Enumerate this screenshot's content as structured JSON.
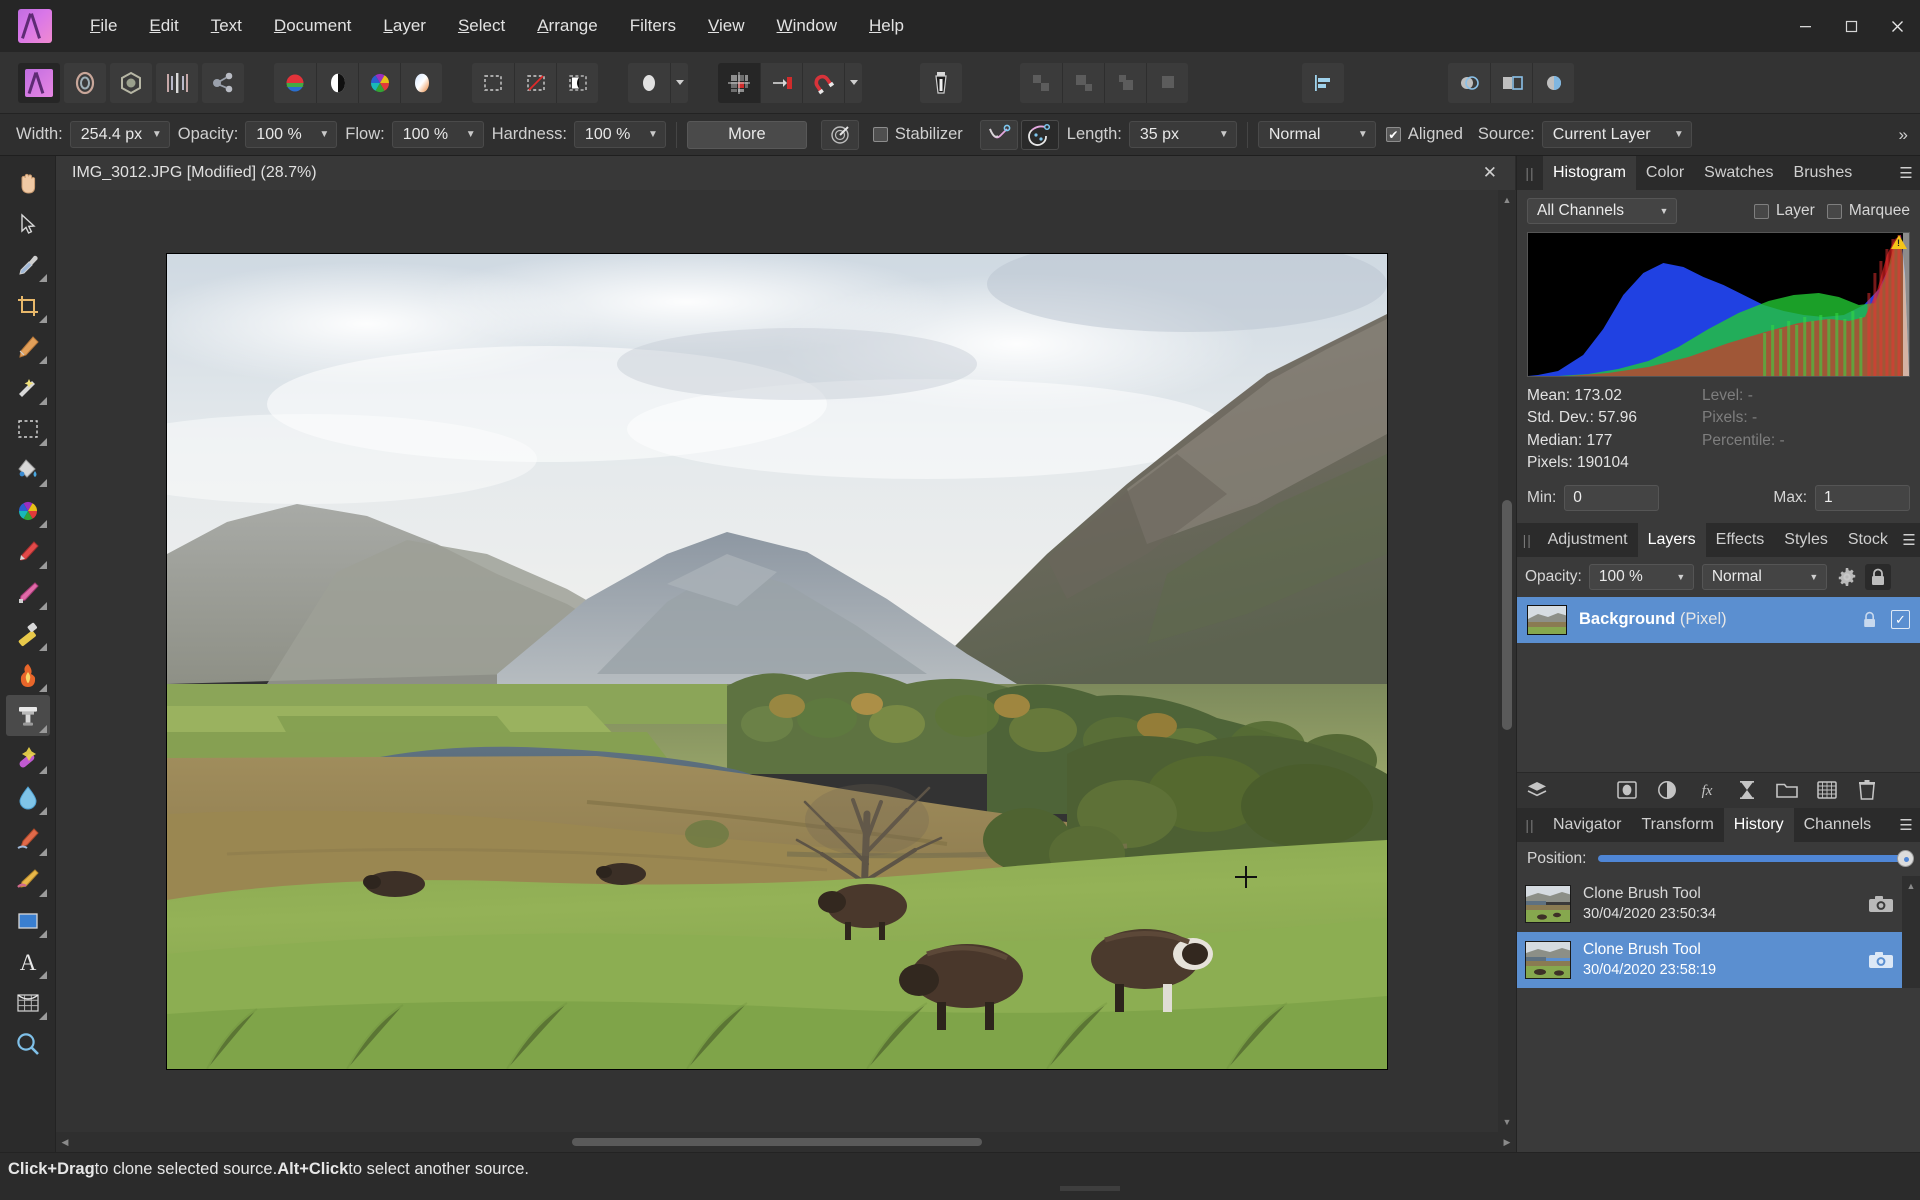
{
  "app": {
    "name": "Affinity Photo",
    "logo_icon": "affinity-photo-logo"
  },
  "menubar": {
    "items": [
      {
        "label": "File",
        "accel": "F"
      },
      {
        "label": "Edit",
        "accel": "E"
      },
      {
        "label": "Text",
        "accel": "T"
      },
      {
        "label": "Document",
        "accel": "D"
      },
      {
        "label": "Layer",
        "accel": "L"
      },
      {
        "label": "Select",
        "accel": "S"
      },
      {
        "label": "Arrange",
        "accel": "A"
      },
      {
        "label": "Filters",
        "accel": ""
      },
      {
        "label": "View",
        "accel": "V"
      },
      {
        "label": "Window",
        "accel": "W"
      },
      {
        "label": "Help",
        "accel": "H"
      }
    ],
    "window_controls": {
      "minimize": "—",
      "maximize": "❐",
      "close": "✕"
    }
  },
  "toolbar": {
    "groups": [
      {
        "buttons": [
          {
            "name": "persona-photo",
            "icon": "affinity-photo-persona",
            "active": true
          },
          {
            "name": "persona-liquify",
            "icon": "liquify-persona",
            "active": false
          },
          {
            "name": "persona-develop",
            "icon": "develop-persona",
            "active": false
          },
          {
            "name": "persona-tone-mapping",
            "icon": "tone-mapping-persona",
            "active": false
          },
          {
            "name": "persona-export",
            "icon": "export-persona",
            "active": false
          }
        ]
      },
      {
        "buttons": [
          {
            "name": "assistant-colour",
            "icon": "colour-swatch-icon",
            "active": false
          },
          {
            "name": "assistant-contrast",
            "icon": "contrast-circle-icon",
            "active": false
          },
          {
            "name": "assistant-colour-wheel",
            "icon": "colour-wheel-icon",
            "active": false
          },
          {
            "name": "assistant-gradient",
            "icon": "gradient-egg-icon",
            "active": false
          }
        ]
      },
      {
        "buttons": [
          {
            "name": "show-selection",
            "icon": "marquee-dashed-icon",
            "active": false
          },
          {
            "name": "refine-selection",
            "icon": "marquee-slash-icon",
            "active": false
          },
          {
            "name": "selection-mask",
            "icon": "selection-mask-icon",
            "active": false
          }
        ]
      },
      {
        "buttons": [
          {
            "name": "pixel-alignment",
            "icon": "ellipse-white-icon",
            "active": false
          },
          {
            "name": "pixel-alignment-menu",
            "icon": "chevron-down-icon",
            "active": false
          }
        ]
      },
      {
        "buttons": [
          {
            "name": "show-grid",
            "icon": "grid-icon",
            "active": true
          },
          {
            "name": "snap-to-edge",
            "icon": "arrow-to-bracket-icon",
            "active": false
          },
          {
            "name": "snapping-magnet",
            "icon": "magnet-icon",
            "active": false
          },
          {
            "name": "snapping-menu",
            "icon": "chevron-down-icon",
            "active": false
          }
        ]
      },
      {
        "buttons": [
          {
            "name": "stack-tool",
            "icon": "battery-stack-icon",
            "active": false
          }
        ]
      },
      {
        "buttons": [
          {
            "name": "align-distribute-1",
            "icon": "align-squares-1-icon",
            "active": false,
            "dim": true
          },
          {
            "name": "align-distribute-2",
            "icon": "align-squares-2-icon",
            "active": false,
            "dim": true
          },
          {
            "name": "align-distribute-3",
            "icon": "align-squares-3-icon",
            "active": false,
            "dim": true
          },
          {
            "name": "align-distribute-4",
            "icon": "align-squares-4-icon",
            "active": false,
            "dim": true
          }
        ]
      },
      {
        "buttons": [
          {
            "name": "align-left",
            "icon": "align-left-icon",
            "active": false
          }
        ]
      },
      {
        "buttons": [
          {
            "name": "view-mode-1",
            "icon": "circle-overlay-icon",
            "active": false
          },
          {
            "name": "view-mode-2",
            "icon": "split-view-icon",
            "active": false
          },
          {
            "name": "view-mode-3",
            "icon": "mirror-view-icon",
            "active": false
          }
        ]
      }
    ]
  },
  "context_bar": {
    "width_label": "Width:",
    "width_value": "254.4 px",
    "opacity_label": "Opacity:",
    "opacity_value": "100 %",
    "flow_label": "Flow:",
    "flow_value": "100 %",
    "hardness_label": "Hardness:",
    "hardness_value": "100 %",
    "more_button": "More",
    "brush_options_icon": "brush-target-icon",
    "stabilizer_label": "Stabilizer",
    "stabilizer_checked": false,
    "stabilizer_mode_rope_icon": "stabilizer-rope-icon",
    "stabilizer_mode_window_icon": "stabilizer-window-icon",
    "length_label": "Length:",
    "length_value": "35 px",
    "blend_mode_value": "Normal",
    "aligned_label": "Aligned",
    "aligned_checked": true,
    "source_label": "Source:",
    "source_value": "Current Layer",
    "overflow_icon": "double-chevron-right-icon"
  },
  "tools": [
    {
      "name": "view-tool",
      "icon": "hand-icon",
      "active": false
    },
    {
      "name": "move-tool",
      "icon": "arrow-cursor-icon",
      "active": false
    },
    {
      "name": "colour-picker-tool",
      "icon": "eyedropper-icon",
      "active": false
    },
    {
      "name": "crop-tool",
      "icon": "crop-icon",
      "active": false
    },
    {
      "name": "selection-brush-tool",
      "icon": "selection-brush-icon",
      "active": false
    },
    {
      "name": "flood-select-tool",
      "icon": "magic-wand-icon",
      "active": false
    },
    {
      "name": "marquee-tool",
      "icon": "rect-marquee-icon",
      "active": false
    },
    {
      "name": "flood-fill-tool",
      "icon": "paint-bucket-icon",
      "active": false
    },
    {
      "name": "gradient-tool",
      "icon": "colour-wheel-gradient-icon",
      "active": false
    },
    {
      "name": "paint-brush-tool",
      "icon": "paint-brush-icon",
      "active": false
    },
    {
      "name": "pixel-tool",
      "icon": "pixel-pencil-icon",
      "active": false
    },
    {
      "name": "erase-brush-tool",
      "icon": "eraser-icon",
      "active": false
    },
    {
      "name": "dodge-brush-tool",
      "icon": "flame-icon",
      "active": false
    },
    {
      "name": "clone-brush-tool",
      "icon": "clone-stamp-icon",
      "active": true
    },
    {
      "name": "healing-brush-tool",
      "icon": "healing-brush-icon",
      "active": false
    },
    {
      "name": "blur-brush-tool",
      "icon": "water-drop-icon",
      "active": false
    },
    {
      "name": "smudge-brush-tool",
      "icon": "smudge-icon",
      "active": false
    },
    {
      "name": "sponge-brush-tool",
      "icon": "sponge-icon",
      "active": false
    },
    {
      "name": "rectangle-tool",
      "icon": "rectangle-shape-icon",
      "active": false
    },
    {
      "name": "artistic-text-tool",
      "icon": "text-a-icon",
      "active": false
    },
    {
      "name": "mesh-warp-tool",
      "icon": "mesh-warp-icon",
      "active": false
    },
    {
      "name": "zoom-tool",
      "icon": "magnifier-icon",
      "active": false
    }
  ],
  "document": {
    "tab_title": "IMG_3012.JPG [Modified] (28.7%)",
    "close_icon": "close-icon",
    "zoom_percent": "28.7%"
  },
  "panels": {
    "top_group": {
      "tabs": [
        {
          "label": "Histogram",
          "active": true
        },
        {
          "label": "Color",
          "active": false
        },
        {
          "label": "Swatches",
          "active": false
        },
        {
          "label": "Brushes",
          "active": false
        }
      ],
      "menu_icon": "panel-menu-icon",
      "grip_icon": "panel-grip-icon"
    },
    "histogram": {
      "channel_select": "All Channels",
      "layer_label": "Layer",
      "layer_checked": false,
      "marquee_label": "Marquee",
      "marquee_checked": false,
      "clipping_warning_icon": "clipping-warning-icon",
      "stats": {
        "mean_label": "Mean:",
        "mean_value": "173.02",
        "stddev_label": "Std. Dev.:",
        "stddev_value": "57.96",
        "median_label": "Median:",
        "median_value": "177",
        "pixels_label": "Pixels:",
        "pixels_value": "190104",
        "level_label": "Level:",
        "level_value": "-",
        "level_pixels_label": "Pixels:",
        "level_pixels_value": "-",
        "percentile_label": "Percentile:",
        "percentile_value": "-"
      },
      "min_label": "Min:",
      "min_value": "0",
      "max_label": "Max:",
      "max_value": "1"
    },
    "mid_group": {
      "tabs": [
        {
          "label": "Adjustment",
          "active": false
        },
        {
          "label": "Layers",
          "active": true
        },
        {
          "label": "Effects",
          "active": false
        },
        {
          "label": "Styles",
          "active": false
        },
        {
          "label": "Stock",
          "active": false
        }
      ],
      "menu_icon": "panel-menu-icon",
      "grip_icon": "panel-grip-icon"
    },
    "layers": {
      "opacity_label": "Opacity:",
      "opacity_value": "100 %",
      "blend_mode": "Normal",
      "settings_icon": "gear-icon",
      "lock_icon": "lock-icon",
      "rows": [
        {
          "name": "Background",
          "type": "(Pixel)",
          "selected": true,
          "locked": true,
          "visible": true
        }
      ],
      "footer_buttons": [
        {
          "name": "layer-stack-button",
          "icon": "layers-stack-icon"
        },
        {
          "name": "mask-layer-button",
          "icon": "mask-icon"
        },
        {
          "name": "adjustment-layer-button",
          "icon": "adjustment-half-circle-icon"
        },
        {
          "name": "live-filter-layer-button",
          "icon": "fx-icon"
        },
        {
          "name": "rasterize-button",
          "icon": "hourglass-icon"
        },
        {
          "name": "add-group-button",
          "icon": "folder-icon"
        },
        {
          "name": "add-pixel-layer-button",
          "icon": "new-pixel-layer-icon"
        },
        {
          "name": "delete-layer-button",
          "icon": "trash-icon"
        }
      ]
    },
    "bottom_group": {
      "tabs": [
        {
          "label": "Navigator",
          "active": false
        },
        {
          "label": "Transform",
          "active": false
        },
        {
          "label": "History",
          "active": true
        },
        {
          "label": "Channels",
          "active": false
        }
      ],
      "menu_icon": "panel-menu-icon",
      "grip_icon": "panel-grip-icon"
    },
    "history": {
      "position_label": "Position:",
      "position_percent": 100,
      "entries": [
        {
          "title": "Clone Brush Tool",
          "timestamp": "30/04/2020 23:50:34",
          "selected": false,
          "snapshot_icon": "camera-icon"
        },
        {
          "title": "Clone Brush Tool",
          "timestamp": "30/04/2020 23:58:19",
          "selected": true,
          "snapshot_icon": "camera-icon"
        }
      ]
    }
  },
  "statusbar": {
    "hint_part1": "Click+Drag",
    "hint_part2": " to clone selected source. ",
    "hint_part3": "Alt+Click",
    "hint_part4": " to select another source."
  },
  "colors": {
    "accent_blue": "#5b8fd0",
    "panel_bg": "#3a3a3a",
    "chrome_bg": "#2b2b2b",
    "toolbar_bg": "#333333",
    "canvas_bg": "#333333",
    "text": "#d8d8d8"
  }
}
